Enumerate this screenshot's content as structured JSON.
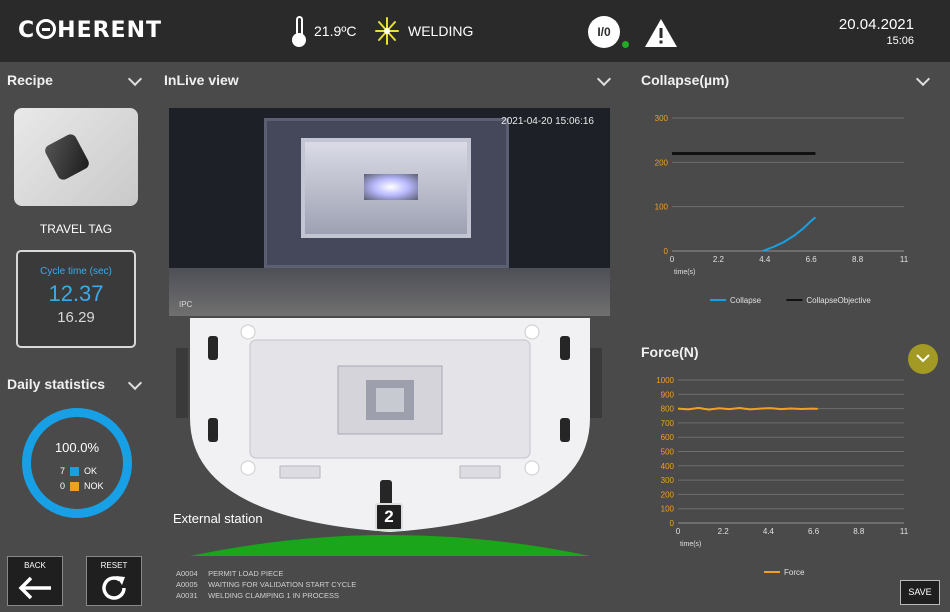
{
  "header": {
    "logo": "COHERENT",
    "temperature": "21.9ºC",
    "process_state": "WELDING",
    "io_label": "I/0",
    "date": "20.04.2021",
    "time": "15:06"
  },
  "recipe": {
    "title": "Recipe",
    "name": "TRAVEL TAG",
    "cycle_time_label": "Cycle time (sec)",
    "cycle_time_current": "12.37",
    "cycle_time_reference": "16.29"
  },
  "daily_statistics": {
    "title": "Daily statistics",
    "percent": "100.0%",
    "ok_count": "7",
    "ok_label": "OK",
    "nok_count": "0",
    "nok_label": "NOK"
  },
  "inlive": {
    "title": "InLive view",
    "timestamp": "2021-04-20 15:06:16",
    "camera_label": "IPC",
    "station_label": "External station",
    "station_number": "2"
  },
  "messages": [
    {
      "code": "A0004",
      "text": "PERMIT LOAD PIECE"
    },
    {
      "code": "A0005",
      "text": "WAITING FOR VALIDATION START CYCLE"
    },
    {
      "code": "A0031",
      "text": "WELDING CLAMPING 1 IN PROCESS"
    }
  ],
  "buttons": {
    "back": "BACK",
    "reset": "RESET",
    "save": "SAVE"
  },
  "colors": {
    "accent_blue": "#18a0e6",
    "nok_orange": "#f0a020",
    "force_orange": "#f0a020",
    "objective_black": "#111111"
  },
  "icons": {
    "temperature": "thermometer-icon",
    "welding": "laser-burst-icon",
    "warning": "warning-triangle-icon",
    "back": "arrow-left-icon",
    "reset": "refresh-icon"
  },
  "chart_data": [
    {
      "type": "line",
      "title": "Collapse(µm)",
      "xlabel": "time(s)",
      "ylabel": "",
      "x_ticks": [
        "0",
        "2.2",
        "4.4",
        "6.6",
        "8.8",
        "11"
      ],
      "y_ticks": [
        "0",
        "100",
        "200",
        "300"
      ],
      "xlim": [
        0,
        11
      ],
      "ylim": [
        0,
        300
      ],
      "grid": true,
      "legend_position": "bottom",
      "series": [
        {
          "name": "Collapse",
          "color": "#18a0e6",
          "x": [
            4.3,
            4.8,
            5.3,
            5.8,
            6.2,
            6.6,
            6.8
          ],
          "y": [
            0,
            9,
            20,
            35,
            50,
            68,
            76
          ]
        },
        {
          "name": "CollapseObjective",
          "color": "#111111",
          "x": [
            0,
            6.8
          ],
          "y": [
            220,
            220
          ]
        }
      ]
    },
    {
      "type": "line",
      "title": "Force(N)",
      "xlabel": "time(s)",
      "ylabel": "",
      "x_ticks": [
        "0",
        "2.2",
        "4.4",
        "6.6",
        "8.8",
        "11"
      ],
      "y_ticks": [
        "0",
        "100",
        "200",
        "300",
        "400",
        "500",
        "600",
        "700",
        "800",
        "900",
        "1000"
      ],
      "xlim": [
        0,
        11
      ],
      "ylim": [
        0,
        1000
      ],
      "grid": true,
      "legend_position": "bottom",
      "series": [
        {
          "name": "Force",
          "color": "#f0a020",
          "x": [
            0,
            0.5,
            1.0,
            1.5,
            2.0,
            2.5,
            3.0,
            3.5,
            4.0,
            4.5,
            5.0,
            5.5,
            6.0,
            6.5,
            6.8
          ],
          "y": [
            800,
            795,
            805,
            793,
            802,
            796,
            804,
            795,
            800,
            803,
            796,
            801,
            797,
            800,
            798
          ]
        }
      ]
    }
  ]
}
